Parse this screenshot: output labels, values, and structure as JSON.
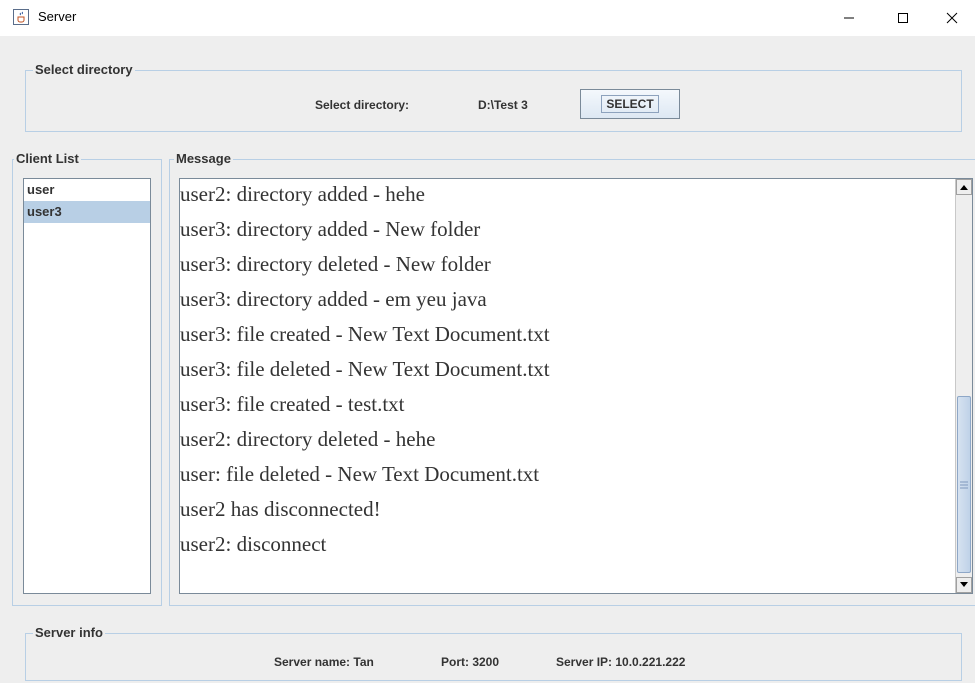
{
  "window": {
    "title": "Server"
  },
  "select_panel": {
    "group_label": "Select directory",
    "label": "Select directory:",
    "path": "D:\\Test 3",
    "button_label": "SELECT"
  },
  "client_list": {
    "group_label": "Client List",
    "items": [
      {
        "label": "user",
        "selected": false
      },
      {
        "label": "user3",
        "selected": true
      }
    ]
  },
  "message_panel": {
    "group_label": "Message",
    "lines": [
      "user2: directory added - hehe",
      "user3: directory added - New folder",
      "user3: directory deleted - New folder",
      "user3: directory added - em yeu java",
      "user3: file created - New Text Document.txt",
      "user3: file deleted - New Text Document.txt",
      "user3: file created - test.txt",
      "user2: directory deleted - hehe",
      "user: file deleted - New Text Document.txt",
      "user2 has disconnected!",
      "user2: disconnect"
    ]
  },
  "server_info": {
    "group_label": "Server info",
    "server_name": "Server name: Tan",
    "port": "Port: 3200",
    "server_ip": "Server IP: 10.0.221.222"
  },
  "icons": {
    "app": "java-cup-icon",
    "minimize": "minimize-icon",
    "maximize": "maximize-icon",
    "close": "close-icon",
    "scroll_up": "arrow-up-icon",
    "scroll_down": "arrow-down-icon"
  },
  "colors": {
    "selection": "#b8cfe5",
    "group_border": "#b8cfe5",
    "background": "#eeeeee"
  }
}
